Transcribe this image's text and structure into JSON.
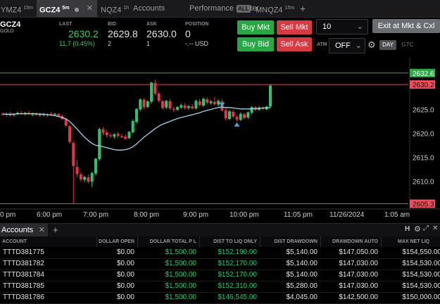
{
  "tabs": [
    {
      "label": "YMZ4",
      "sup": "15m"
    },
    {
      "label": "GCZ4",
      "sup": "5m"
    },
    {
      "label": "NQZ4",
      "sup": "1h"
    },
    {
      "label": "Accounts"
    },
    {
      "label": "Performance Center",
      "badge": "ALL"
    },
    {
      "label": "MNQZ4",
      "sup": "15m"
    },
    {
      "label": "+"
    }
  ],
  "instrument": {
    "symbol": "GCZ4",
    "name": "GOLD"
  },
  "quote": {
    "last_label": "LAST",
    "last": "2630.2",
    "change": "11.7 (0.45%)",
    "bid_label": "BID",
    "bid": "2629.8",
    "bid_size": "2",
    "ask_label": "ASK",
    "ask": "2630.0",
    "ask_size": "1",
    "position_label": "POSITION",
    "position": "0",
    "position_pl": "-.-- USD"
  },
  "order": {
    "buy_mkt": "Buy Mkt",
    "sell_mkt": "Sell Mkt",
    "buy_bid": "Buy Bid",
    "sell_ask": "Sell Ask",
    "quantity": "10",
    "exit": "Exit at Mkt & Cxl",
    "atm_label": "ATM",
    "atm_value": "OFF",
    "tif_day": "DAY",
    "tif_gtc": "GTC"
  },
  "colors": {
    "up": "#28c76f",
    "down": "#e8344a",
    "ema": "#9fd4ea",
    "hline_green": "#2fa84a",
    "hline_red": "#d84b55"
  },
  "chart_data": {
    "type": "candlestick",
    "y_ticks": [
      "2625.0",
      "2620.0",
      "2615.0",
      "2610.0"
    ],
    "y_range": [
      2604.2,
      2635.8
    ],
    "price_labels": [
      {
        "value": "2632.6",
        "color": "green"
      },
      {
        "value": "2630.2",
        "color": "red"
      },
      {
        "value": "2605.3",
        "color": "red"
      }
    ],
    "x_ticks": [
      "0 pm",
      "6:00 pm",
      "7:00 pm",
      "8:00 pm",
      "9:00 pm",
      "10:00 pm",
      "11:05 pm",
      "11/26/2024",
      "1:05 am"
    ],
    "candles": [
      [
        2624.1,
        2624.4,
        2623.7,
        2623.9
      ],
      [
        2623.9,
        2624.3,
        2623.6,
        2624.0
      ],
      [
        2624.0,
        2624.5,
        2623.6,
        2623.7
      ],
      [
        2623.8,
        2624.2,
        2623.5,
        2624.0
      ],
      [
        2624.1,
        2624.6,
        2623.8,
        2624.3
      ],
      [
        2624.2,
        2624.6,
        2623.9,
        2624.0
      ],
      [
        2624.0,
        2624.5,
        2623.7,
        2624.3
      ],
      [
        2624.3,
        2624.7,
        2623.9,
        2624.0
      ],
      [
        2623.9,
        2624.4,
        2623.6,
        2624.2
      ],
      [
        2624.1,
        2624.4,
        2623.7,
        2623.8
      ],
      [
        2623.8,
        2624.3,
        2623.5,
        2624.1
      ],
      [
        2624.0,
        2624.4,
        2623.6,
        2623.7
      ],
      [
        2623.8,
        2624.2,
        2623.5,
        2624.0
      ],
      [
        2624.1,
        2624.5,
        2623.8,
        2623.9
      ],
      [
        2623.9,
        2624.2,
        2623.6,
        2624.1
      ],
      [
        2624.0,
        2624.3,
        2623.5,
        2623.6
      ],
      [
        2623.6,
        2623.9,
        2622.8,
        2623.0
      ],
      [
        2623.0,
        2623.3,
        2621.4,
        2621.6
      ],
      [
        2621.5,
        2621.8,
        2617.9,
        2618.2
      ],
      [
        2618.0,
        2618.4,
        2605.3,
        2613.2
      ],
      [
        2613.0,
        2614.5,
        2610.8,
        2611.5
      ],
      [
        2611.4,
        2611.9,
        2609.9,
        2610.4
      ],
      [
        2610.3,
        2611.2,
        2609.8,
        2610.9
      ],
      [
        2610.8,
        2611.4,
        2609.5,
        2609.9
      ],
      [
        2609.9,
        2612.0,
        2608.8,
        2611.7
      ],
      [
        2611.6,
        2614.9,
        2611.2,
        2614.7
      ],
      [
        2614.6,
        2621.2,
        2614.2,
        2620.9
      ],
      [
        2620.8,
        2621.3,
        2619.6,
        2620.1
      ],
      [
        2620.2,
        2620.7,
        2619.1,
        2619.6
      ],
      [
        2619.6,
        2620.1,
        2619.0,
        2619.4
      ],
      [
        2619.3,
        2620.1,
        2618.9,
        2619.8
      ],
      [
        2619.9,
        2620.3,
        2619.1,
        2619.5
      ],
      [
        2619.4,
        2619.9,
        2619.0,
        2619.2
      ],
      [
        2619.3,
        2619.8,
        2618.6,
        2618.9
      ],
      [
        2619.0,
        2620.5,
        2618.8,
        2620.3
      ],
      [
        2620.2,
        2622.9,
        2620.0,
        2622.6
      ],
      [
        2622.4,
        2625.3,
        2622.0,
        2625.1
      ],
      [
        2625.0,
        2627.3,
        2624.6,
        2627.1
      ],
      [
        2627.0,
        2627.4,
        2625.0,
        2625.5
      ],
      [
        2625.5,
        2626.9,
        2625.2,
        2626.7
      ],
      [
        2626.6,
        2630.8,
        2626.2,
        2630.6
      ],
      [
        2630.5,
        2631.2,
        2628.0,
        2628.3
      ],
      [
        2628.3,
        2628.7,
        2626.4,
        2626.8
      ],
      [
        2626.7,
        2627.0,
        2625.0,
        2625.3
      ],
      [
        2625.4,
        2627.0,
        2625.1,
        2626.8
      ],
      [
        2626.7,
        2627.2,
        2624.9,
        2625.2
      ],
      [
        2625.1,
        2625.6,
        2624.5,
        2624.9
      ],
      [
        2624.9,
        2625.7,
        2624.7,
        2625.5
      ],
      [
        2625.4,
        2626.2,
        2625.1,
        2625.9
      ],
      [
        2625.8,
        2626.3,
        2625.0,
        2625.3
      ],
      [
        2625.3,
        2625.9,
        2624.9,
        2625.7
      ],
      [
        2625.6,
        2626.1,
        2625.0,
        2625.2
      ],
      [
        2625.2,
        2627.1,
        2625.0,
        2626.8
      ],
      [
        2626.7,
        2627.2,
        2625.6,
        2625.9
      ],
      [
        2625.8,
        2627.5,
        2625.5,
        2627.2
      ],
      [
        2627.1,
        2627.5,
        2626.1,
        2626.4
      ],
      [
        2626.3,
        2627.0,
        2626.0,
        2626.7
      ],
      [
        2626.6,
        2627.6,
        2625.8,
        2626.1
      ],
      [
        2626.0,
        2627.1,
        2625.6,
        2626.8
      ],
      [
        2626.7,
        2627.2,
        2624.5,
        2624.8
      ],
      [
        2624.8,
        2625.3,
        2622.7,
        2623.1
      ],
      [
        2623.0,
        2624.9,
        2622.8,
        2624.6
      ],
      [
        2624.5,
        2624.9,
        2623.2,
        2623.5
      ],
      [
        2623.4,
        2623.8,
        2622.5,
        2622.9
      ],
      [
        2622.8,
        2624.4,
        2622.6,
        2624.1
      ],
      [
        2624.0,
        2624.3,
        2622.9,
        2623.2
      ],
      [
        2623.3,
        2624.6,
        2623.0,
        2624.4
      ],
      [
        2624.3,
        2625.7,
        2623.9,
        2625.5
      ],
      [
        2625.4,
        2625.8,
        2624.6,
        2624.9
      ],
      [
        2624.9,
        2625.7,
        2624.7,
        2625.4
      ],
      [
        2625.3,
        2625.6,
        2624.9,
        2625.1
      ],
      [
        2625.0,
        2625.8,
        2624.8,
        2625.6
      ],
      [
        2625.6,
        2630.2,
        2625.3,
        2630.0
      ]
    ],
    "ema": [
      2624.0,
      2624.0,
      2624.0,
      2624.0,
      2624.1,
      2624.1,
      2624.1,
      2624.1,
      2624.1,
      2624.1,
      2624.0,
      2624.0,
      2623.9,
      2623.8,
      2623.7,
      2623.5,
      2623.3,
      2623.0,
      2622.5,
      2621.7,
      2620.9,
      2620.0,
      2619.2,
      2618.5,
      2617.9,
      2617.5,
      2617.4,
      2617.2,
      2617.0,
      2616.8,
      2616.6,
      2616.5,
      2616.5,
      2616.6,
      2616.8,
      2617.2,
      2617.8,
      2618.5,
      2619.2,
      2619.8,
      2620.4,
      2621.0,
      2621.5,
      2621.9,
      2622.2,
      2622.5,
      2622.8,
      2623.1,
      2623.3,
      2623.5,
      2623.7,
      2623.9,
      2624.1,
      2624.3,
      2624.6,
      2624.8,
      2625.0,
      2625.2,
      2625.4,
      2625.5,
      2625.4,
      2625.4,
      2625.3,
      2625.2,
      2625.1,
      2625.1,
      2625.1,
      2625.1,
      2625.2,
      2625.2,
      2625.3,
      2625.3,
      2625.4
    ],
    "markers": [
      {
        "index": 59,
        "type": "sell",
        "price": 2625.8
      },
      {
        "index": 63,
        "type": "buy",
        "price": 2622.0
      }
    ]
  },
  "accounts_panel": {
    "tab": "Accounts",
    "add": "+",
    "columns": [
      "ACCOUNT",
      "DOLLAR OPEN",
      "DOLLAR TOTAL P L",
      "DIST TO LIQ ONLY",
      "DIST DRAWDOWN",
      "DRAWDOWN AUTO",
      "MAX NET LIQ"
    ],
    "rows": [
      [
        "TTTD381775",
        "$0.00",
        "$1,500.00",
        "$152,190.00",
        "$5,140.00",
        "$147,050.00",
        "$154,550.00"
      ],
      [
        "TTTD381782",
        "$0.00",
        "$1,500.00",
        "$152,170.00",
        "$5,140.00",
        "$147,030.00",
        "$154,530.00"
      ],
      [
        "TTTD381784",
        "$0.00",
        "$1,500.00",
        "$152,170.00",
        "$5,140.00",
        "$147,030.00",
        "$154,530.00"
      ],
      [
        "TTTD381785",
        "$0.00",
        "$1,500.00",
        "$152,310.00",
        "$5,280.00",
        "$147,030.00",
        "$154,530.00"
      ],
      [
        "TTTD381786",
        "$0.00",
        "$1,500.00",
        "$146,545.00",
        "$4,045.00",
        "$142,500.00",
        "$150,000.00"
      ]
    ]
  }
}
